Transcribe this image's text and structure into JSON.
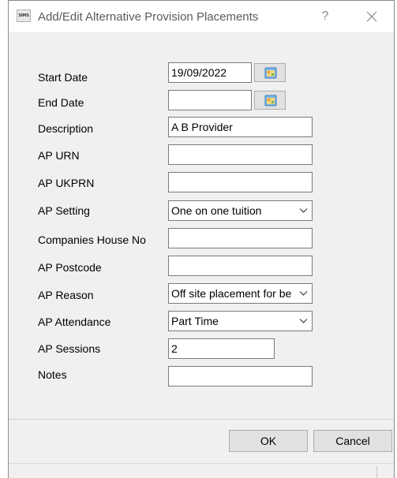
{
  "window": {
    "title": "Add/Edit Alternative Provision Placements",
    "app_icon_text": "SIMS",
    "help_glyph": "?"
  },
  "fields": {
    "start_date": {
      "label": "Start Date",
      "value": "19/09/2022"
    },
    "end_date": {
      "label": "End Date",
      "value": ""
    },
    "description": {
      "label": "Description",
      "value": "A B Provider"
    },
    "ap_urn": {
      "label": "AP URN",
      "value": ""
    },
    "ap_ukprn": {
      "label": "AP UKPRN",
      "value": ""
    },
    "ap_setting": {
      "label": "AP Setting",
      "value": "One on one tuition"
    },
    "companies_house_no": {
      "label": "Companies House No",
      "value": ""
    },
    "ap_postcode": {
      "label": "AP Postcode",
      "value": ""
    },
    "ap_reason": {
      "label": "AP Reason",
      "value": "Off site placement for be"
    },
    "ap_attendance": {
      "label": "AP Attendance",
      "value": "Part Time"
    },
    "ap_sessions": {
      "label": "AP Sessions",
      "value": "2"
    },
    "notes": {
      "label": "Notes",
      "value": ""
    }
  },
  "buttons": {
    "ok": "OK",
    "cancel": "Cancel"
  },
  "icons": {
    "calendar": "calendar-icon",
    "dropdown": "chevron-down-icon",
    "close": "close-icon"
  }
}
